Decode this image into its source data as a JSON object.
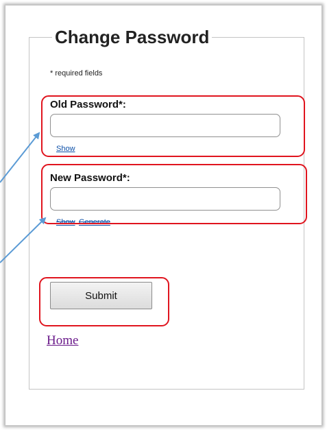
{
  "form": {
    "title": "Change Password",
    "required_note": "* required fields",
    "old_password": {
      "label": "Old Password*:",
      "value": "",
      "show_link": "Show"
    },
    "new_password": {
      "label": "New Password*:",
      "value": "",
      "show_link": "Show",
      "generate_link": "Generate"
    },
    "submit_label": "Submit",
    "home_link": "Home"
  },
  "annotations": {
    "highlight_color": "#e0141e",
    "arrow_color": "#5b9bd5"
  }
}
